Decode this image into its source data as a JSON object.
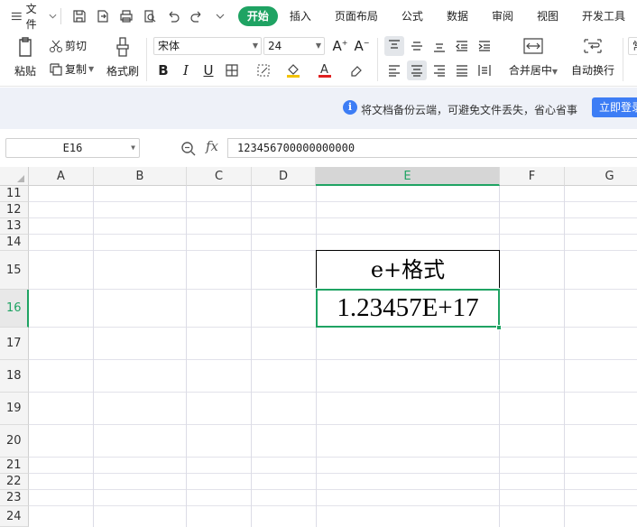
{
  "menubar": {
    "file_label": "文件",
    "tabs": [
      "开始",
      "插入",
      "页面布局",
      "公式",
      "数据",
      "审阅",
      "视图",
      "开发工具"
    ],
    "active_tab": "开始",
    "quick_icons": [
      "save-icon",
      "export-icon",
      "print-icon",
      "print-preview-icon",
      "undo-icon",
      "redo-icon",
      "more-icon"
    ]
  },
  "ribbon": {
    "paste": "粘贴",
    "cut": "剪切",
    "copy": "复制",
    "format_painter": "格式刷",
    "font_name": "宋体",
    "font_size": "24",
    "merge_center": "合并居中",
    "wrap_text": "自动换行",
    "number_format": "常"
  },
  "notice": {
    "text": "将文档备份云端，可避免文件丢失，省心省事",
    "button": "立即登录"
  },
  "formula_bar": {
    "cell_ref": "E16",
    "fx": "fx",
    "value": "123456700000000000"
  },
  "sheet": {
    "columns": [
      "A",
      "B",
      "C",
      "D",
      "E",
      "F",
      "G"
    ],
    "selected_column": "E",
    "rows": [
      "11",
      "12",
      "13",
      "14",
      "15",
      "16",
      "17",
      "18",
      "19",
      "20",
      "21",
      "22",
      "23",
      "24"
    ],
    "selected_row": "16",
    "cells": {
      "E15": "e+格式",
      "E16": "1.23457E+17"
    }
  },
  "colors": {
    "accent": "#1fa363",
    "info_blue": "#3d7df5"
  }
}
